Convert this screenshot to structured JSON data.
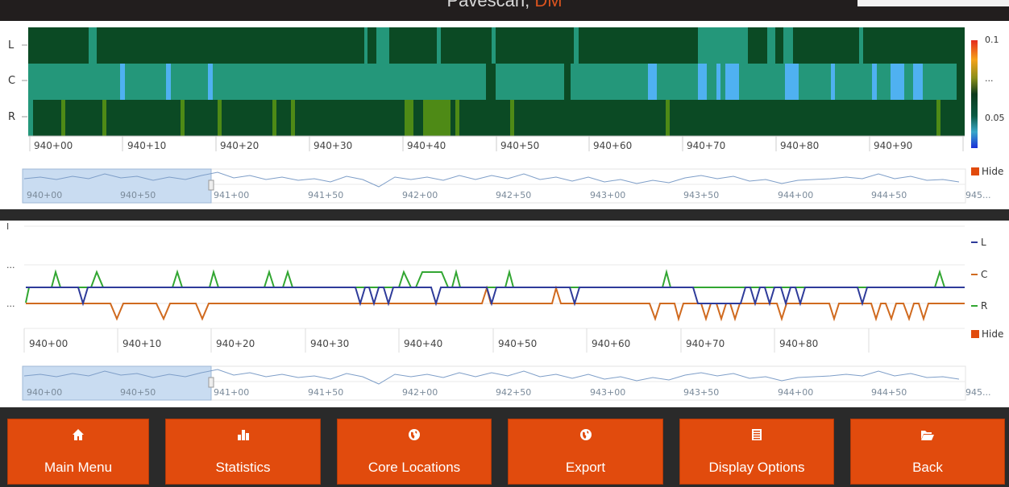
{
  "app": {
    "title": "Pavescan",
    "title_accent": "DM"
  },
  "heatmap": {
    "rows": [
      "L",
      "C",
      "R"
    ],
    "colorbar_labels": [
      "0.1",
      "...",
      "0.05"
    ],
    "x_ticks": [
      "940+00",
      "940+10",
      "940+20",
      "940+30",
      "940+40",
      "940+50",
      "940+60",
      "940+70",
      "940+80",
      "940+90"
    ],
    "hide_label": "Hide"
  },
  "linechart": {
    "y_ticks": [
      "I",
      "...",
      "..."
    ],
    "legend": [
      "L",
      "C",
      "R"
    ],
    "x_ticks": [
      "940+00",
      "940+10",
      "940+20",
      "940+30",
      "940+40",
      "940+50",
      "940+60",
      "940+70",
      "940+80"
    ],
    "hide_label": "Hide"
  },
  "overview": {
    "ticks": [
      "940+00",
      "940+50",
      "941+00",
      "941+50",
      "942+00",
      "942+50",
      "943+00",
      "943+50",
      "944+00",
      "944+50",
      "945..."
    ]
  },
  "colors": {
    "accent": "#e14b0d",
    "series_L": "#2e3b9a",
    "series_C": "#d06a1f",
    "series_R": "#32a632",
    "heat_dark": "#0b4a24",
    "heat_teal": "#24977a",
    "heat_blue": "#4fb1f1",
    "heat_olive": "#4e8a16"
  },
  "buttons": [
    {
      "label": "Main Menu",
      "icon": "home-icon"
    },
    {
      "label": "Statistics",
      "icon": "bar-chart-icon"
    },
    {
      "label": "Core Locations",
      "icon": "globe-icon"
    },
    {
      "label": "Export",
      "icon": "globe-icon"
    },
    {
      "label": "Display Options",
      "icon": "table-icon"
    },
    {
      "label": "Back",
      "icon": "folder-open-icon"
    }
  ]
}
